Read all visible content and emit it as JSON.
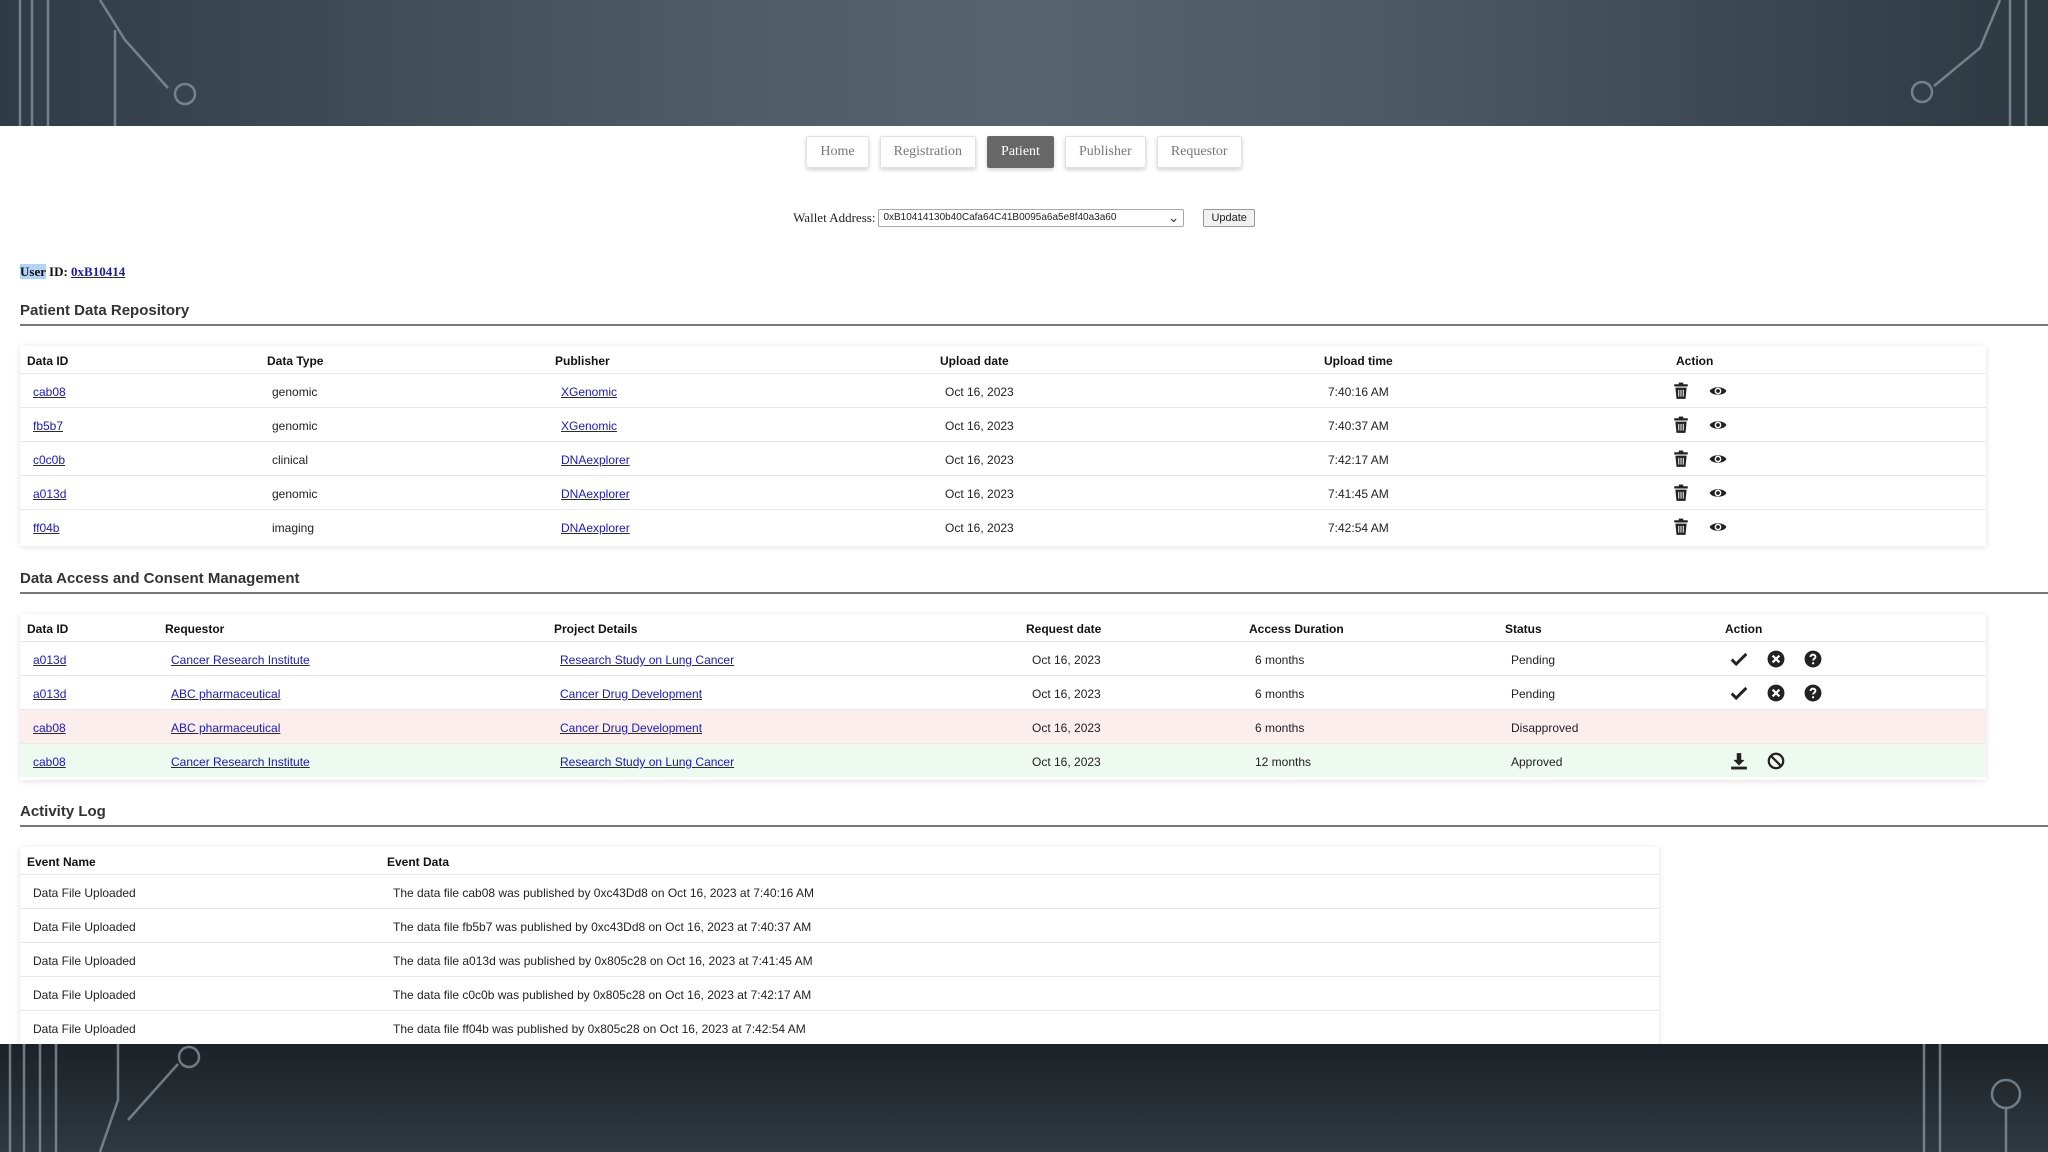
{
  "nav": {
    "tabs": [
      {
        "label": "Home",
        "active": false
      },
      {
        "label": "Registration",
        "active": false
      },
      {
        "label": "Patient",
        "active": true
      },
      {
        "label": "Publisher",
        "active": false
      },
      {
        "label": "Requestor",
        "active": false
      }
    ]
  },
  "wallet": {
    "label": "Wallet Address:",
    "value": "0xB10414130b40Cafa64C41B0095a6a5e8f40a3a60",
    "update_label": "Update"
  },
  "user": {
    "label_prefix": "User",
    "label_suffix": " ID: ",
    "id": "0xB10414"
  },
  "repository": {
    "title": "Patient Data Repository",
    "headers": [
      "Data ID",
      "Data Type",
      "Publisher",
      "Upload date",
      "Upload time",
      "Action"
    ],
    "rows": [
      {
        "id": "cab08",
        "type": "genomic",
        "publisher": "XGenomic",
        "date": "Oct 16, 2023",
        "time": "7:40:16 AM"
      },
      {
        "id": "fb5b7",
        "type": "genomic",
        "publisher": "XGenomic",
        "date": "Oct 16, 2023",
        "time": "7:40:37 AM"
      },
      {
        "id": "c0c0b",
        "type": "clinical",
        "publisher": "DNAexplorer",
        "date": "Oct 16, 2023",
        "time": "7:42:17 AM"
      },
      {
        "id": "a013d",
        "type": "genomic",
        "publisher": "DNAexplorer",
        "date": "Oct 16, 2023",
        "time": "7:41:45 AM"
      },
      {
        "id": "ff04b",
        "type": "imaging",
        "publisher": "DNAexplorer",
        "date": "Oct 16, 2023",
        "time": "7:42:54 AM"
      }
    ]
  },
  "consent": {
    "title": "Data Access and Consent Management",
    "headers": [
      "Data ID",
      "Requestor",
      "Project Details",
      "Request date",
      "Access Duration",
      "Status",
      "Action"
    ],
    "rows": [
      {
        "id": "a013d",
        "requestor": "Cancer Research Institute",
        "project": "Research Study on Lung Cancer",
        "date": "Oct 16, 2023",
        "duration": "6 months",
        "status": "Pending"
      },
      {
        "id": "a013d",
        "requestor": "ABC pharmaceutical",
        "project": "Cancer Drug Development",
        "date": "Oct 16, 2023",
        "duration": "6 months",
        "status": "Pending"
      },
      {
        "id": "cab08",
        "requestor": "ABC pharmaceutical",
        "project": "Cancer Drug Development",
        "date": "Oct 16, 2023",
        "duration": "6 months",
        "status": "Disapproved"
      },
      {
        "id": "cab08",
        "requestor": "Cancer Research Institute",
        "project": "Research Study on Lung Cancer",
        "date": "Oct 16, 2023",
        "duration": "12 months",
        "status": "Approved"
      }
    ]
  },
  "activity": {
    "title": "Activity Log",
    "headers": [
      "Event Name",
      "Event Data"
    ],
    "rows": [
      {
        "name": "Data File Uploaded",
        "data": "The data file cab08 was published by 0xc43Dd8 on Oct 16, 2023 at 7:40:16 AM"
      },
      {
        "name": "Data File Uploaded",
        "data": "The data file fb5b7 was published by 0xc43Dd8 on Oct 16, 2023 at 7:40:37 AM"
      },
      {
        "name": "Data File Uploaded",
        "data": "The data file a013d was published by 0x805c28 on Oct 16, 2023 at 7:41:45 AM"
      },
      {
        "name": "Data File Uploaded",
        "data": "The data file c0c0b was published by 0x805c28 on Oct 16, 2023 at 7:42:17 AM"
      },
      {
        "name": "Data File Uploaded",
        "data": "The data file ff04b was published by 0x805c28 on Oct 16, 2023 at 7:42:54 AM"
      }
    ]
  },
  "icons": {
    "delete": "trash-icon",
    "view": "eye-icon",
    "approve": "check-icon",
    "reject": "x-circle-icon",
    "info": "question-circle-icon",
    "download": "download-icon",
    "revoke": "ban-icon"
  },
  "colors": {
    "active_tab": "#676767",
    "link": "#1a1ab8",
    "disapproved_row": "#fdeeee",
    "approved_row": "#eef9ef"
  }
}
